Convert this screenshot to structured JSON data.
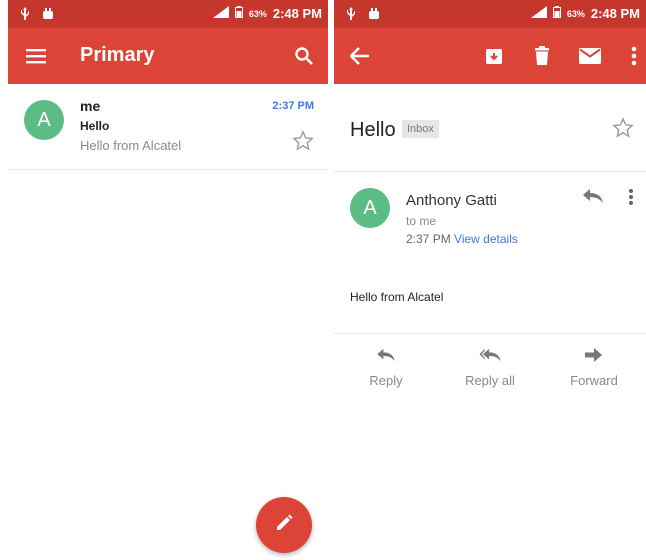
{
  "colors": {
    "status_bar": "#c5372c",
    "app_bar": "#db4437",
    "avatar": "#5bbc84",
    "link": "#3c7be0"
  },
  "status_bar": {
    "battery": "63%",
    "time": "2:48 PM"
  },
  "inbox_screen": {
    "title": "Primary",
    "emails": [
      {
        "sender": "me",
        "subject": "Hello",
        "snippet": "Hello from Alcatel",
        "time": "2:37 PM",
        "avatar_letter": "A"
      }
    ]
  },
  "detail_screen": {
    "subject": "Hello",
    "label": "Inbox",
    "message": {
      "avatar_letter": "A",
      "sender": "Anthony Gatti",
      "to": "to me",
      "time": "2:37 PM",
      "view_details": "View details",
      "body": "Hello from Alcatel"
    },
    "actions": {
      "reply": "Reply",
      "reply_all": "Reply all",
      "forward": "Forward"
    }
  }
}
